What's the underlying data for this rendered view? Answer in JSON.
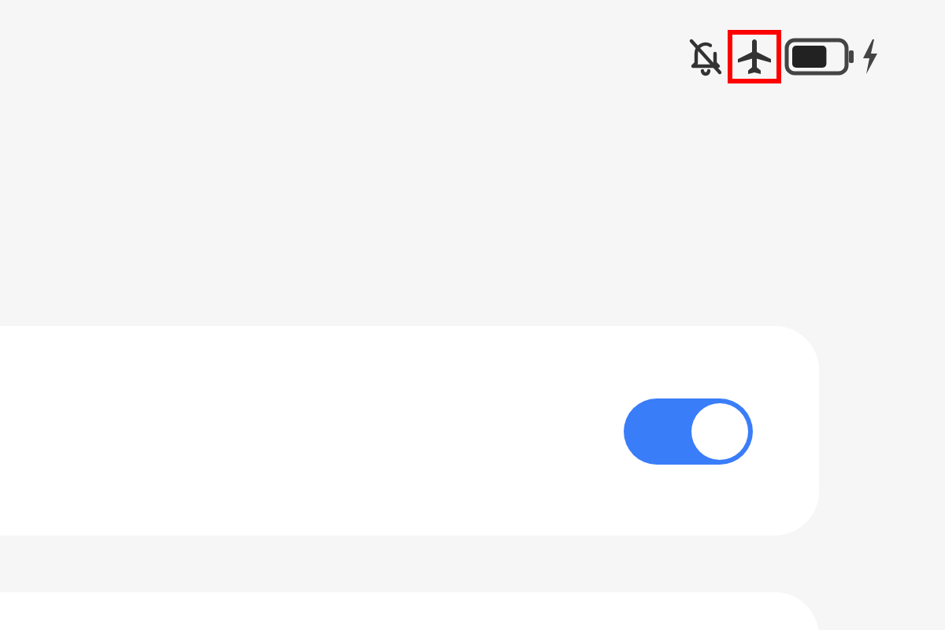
{
  "status_bar": {
    "silent": true,
    "airplane_mode": true,
    "airplane_highlighted": true,
    "battery": {
      "level": 0.7,
      "charging": true
    }
  },
  "cards": [
    {
      "kind": "toggle",
      "on": true
    },
    {
      "kind": "blank"
    }
  ]
}
